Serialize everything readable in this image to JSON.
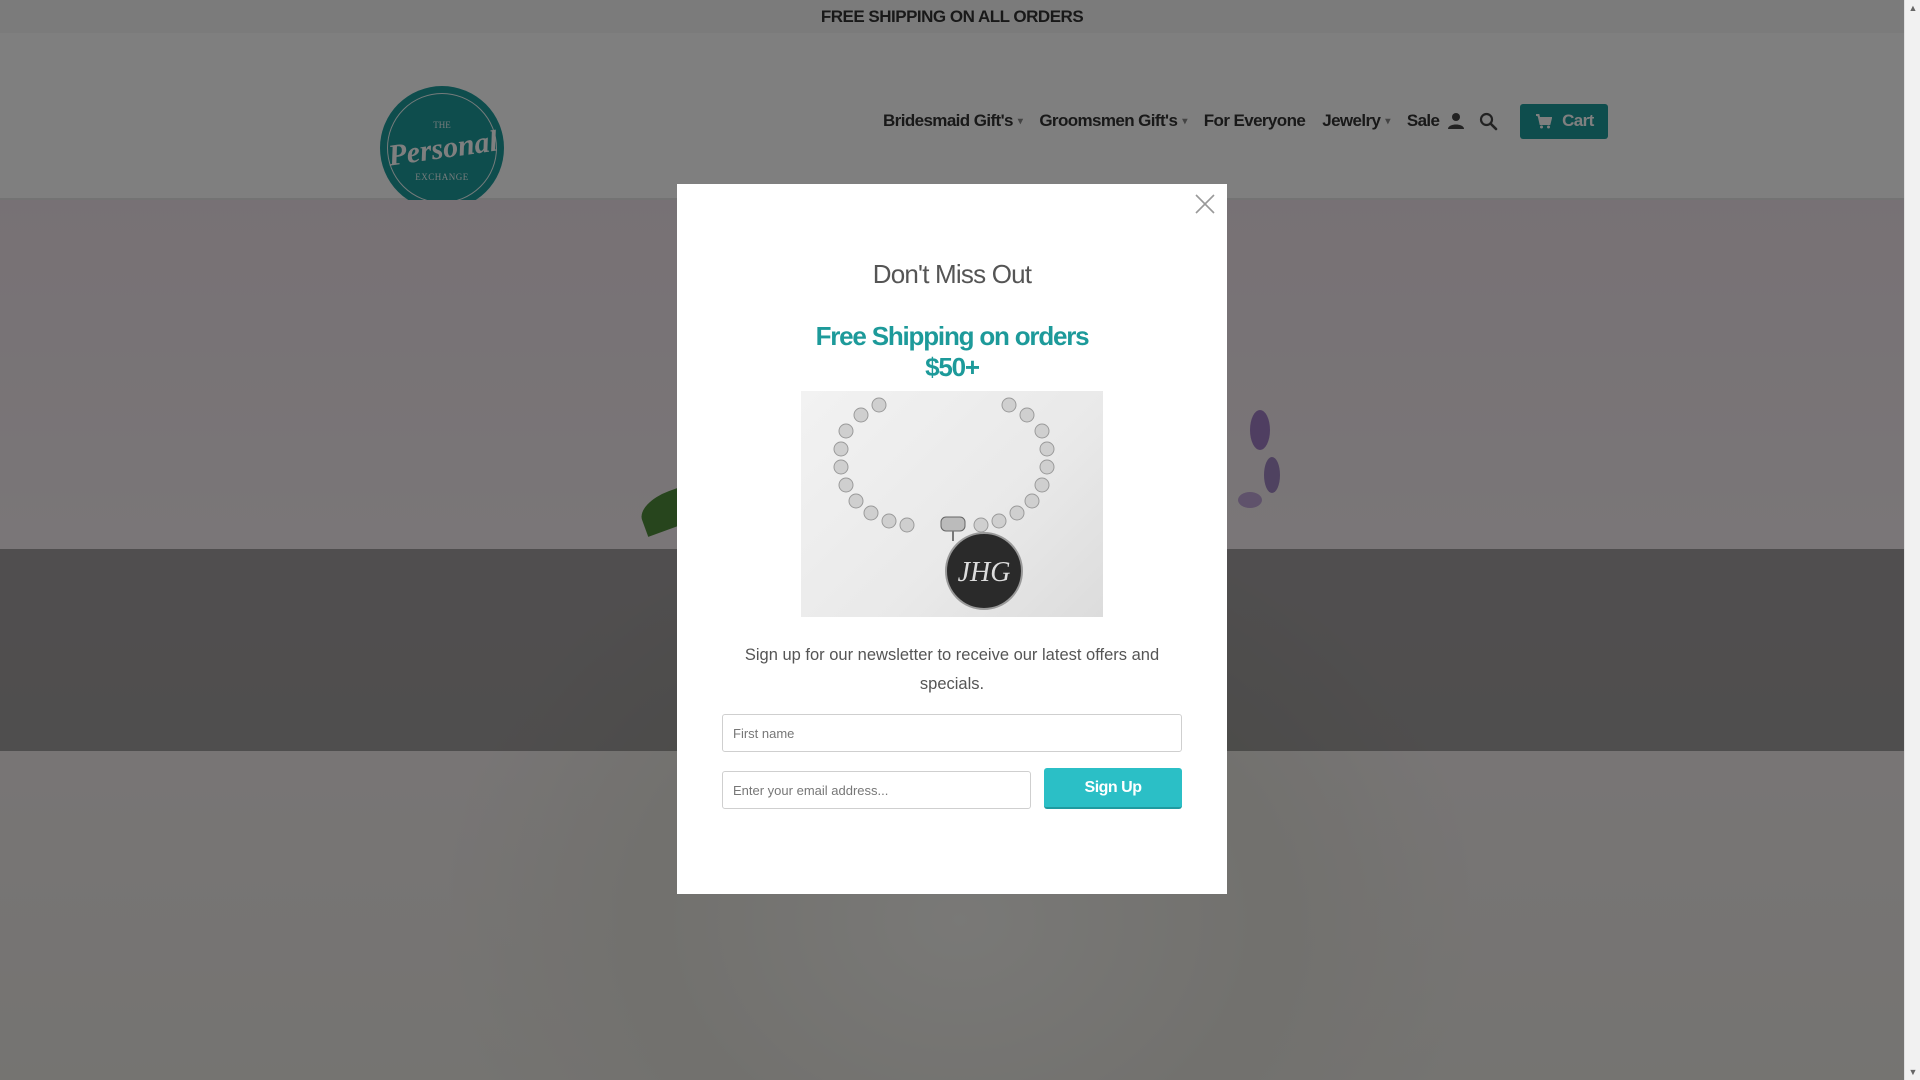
{
  "announcement": "FREE SHIPPING ON ALL ORDERS",
  "brand": {
    "logo_top": "THE",
    "logo_main": "Personal",
    "logo_bottom": "EXCHANGE"
  },
  "nav": {
    "items": [
      {
        "label": "Bridesmaid Gift's",
        "caret": "▾"
      },
      {
        "label": "Groomsmen Gift's",
        "caret": "▾"
      },
      {
        "label": "For Everyone"
      },
      {
        "label": "Jewelry",
        "caret": "▾"
      },
      {
        "label": "Sale"
      }
    ],
    "account_icon": "person-icon",
    "search_icon": "search-icon",
    "cart_label": "Cart",
    "cart_icon": "cart-icon"
  },
  "modal": {
    "title": "Don't Miss Out",
    "promo_headline_line1": "Free Shipping on orders",
    "promo_headline_line2": "$50+",
    "promo_monogram": "JHG",
    "text": "Sign up for our newsletter to receive our latest offers and specials.",
    "first_name_placeholder": "First name",
    "email_placeholder": "Enter your email address...",
    "signup_label": "Sign Up",
    "close_icon": "close-icon"
  },
  "colors": {
    "brand_teal": "#1d9a9a",
    "button_teal": "#2bbfc6"
  }
}
